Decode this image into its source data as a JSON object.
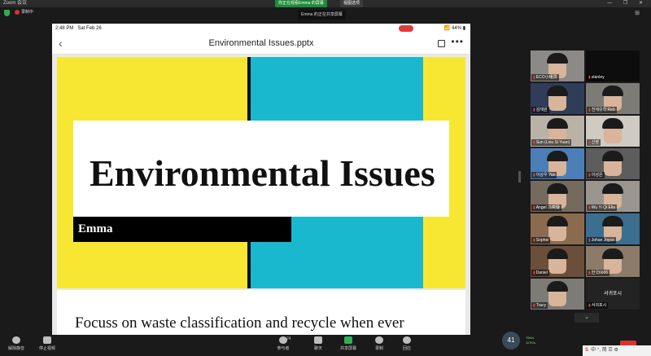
{
  "window": {
    "title": "Zoom 会议",
    "controls": "— ❐ ✕"
  },
  "banners": {
    "screen_share": "你正在观看Emma 的屏幕",
    "view_options": "视图选项",
    "notice": "Emma 的正在共享屏幕"
  },
  "top": {
    "recording": "录制中",
    "view_label": "⊞"
  },
  "ipad": {
    "time": "2:48 PM",
    "date": "Sat Feb 26",
    "battery": "44%",
    "doc_title": "Environmental Issues.pptx",
    "back": "‹",
    "more": "•••"
  },
  "slide": {
    "title": "Environmental Issues",
    "author": "Emma",
    "next_text": "Focuss on waste classification and recycle when ever"
  },
  "colors": {
    "yellow": "#f7e732",
    "cyan": "#1ab8cf",
    "black": "#000000"
  },
  "participants": [
    {
      "name": "ECO小组员",
      "type": "video",
      "bg": "bg1"
    },
    {
      "name": "stanley",
      "type": "black",
      "bg": ""
    },
    {
      "name": "김재원",
      "type": "video",
      "bg": "bg2"
    },
    {
      "name": "천재유학 Reb",
      "type": "video",
      "bg": "bg3"
    },
    {
      "name": "Sun (Liou Si Yuan)",
      "type": "video",
      "bg": "bg4"
    },
    {
      "name": "신영",
      "type": "video",
      "bg": "bg6"
    },
    {
      "name": "이상우 Yan",
      "type": "video",
      "bg": "bg5"
    },
    {
      "name": "이성은",
      "type": "video",
      "bg": "bg7"
    },
    {
      "name": "Angel 冯奕璇",
      "type": "video",
      "bg": "bg8"
    },
    {
      "name": "Wu Yi Qi Elia",
      "type": "video",
      "bg": "bg9"
    },
    {
      "name": "Sophie",
      "type": "video",
      "bg": "bg10"
    },
    {
      "name": "Johan Joyce",
      "type": "video",
      "bg": "bg11"
    },
    {
      "name": "Daniel",
      "type": "video",
      "bg": "bg12"
    },
    {
      "name": "한국6666",
      "type": "video",
      "bg": "bg13"
    },
    {
      "name": "Tracy",
      "type": "video",
      "bg": "bg3"
    },
    {
      "name": "서귀포시",
      "type": "text",
      "bg": ""
    }
  ],
  "toolbar": {
    "unmute": "解除静音",
    "stop_video": "停止视频",
    "participants_count": "24",
    "participants": "参与者",
    "chat": "聊天",
    "share": "共享屏幕",
    "record": "录制",
    "reactions": "回应",
    "end": "结束"
  },
  "network": {
    "speed": "41",
    "up": "75K/s",
    "down": "117K/s"
  },
  "ime": {
    "brand": "S",
    "text": "中·°, 简 ☰ ⚙"
  }
}
